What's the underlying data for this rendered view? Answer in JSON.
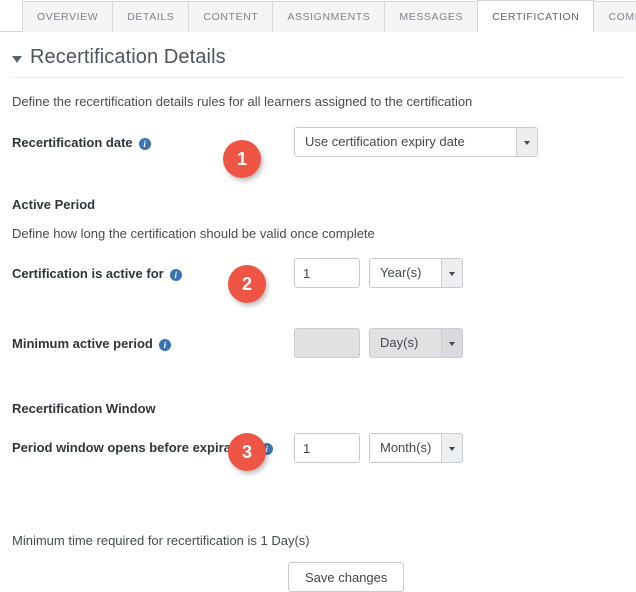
{
  "tabs": [
    {
      "label": "OVERVIEW",
      "active": false
    },
    {
      "label": "DETAILS",
      "active": false
    },
    {
      "label": "CONTENT",
      "active": false
    },
    {
      "label": "ASSIGNMENTS",
      "active": false
    },
    {
      "label": "MESSAGES",
      "active": false
    },
    {
      "label": "CERTIFICATION",
      "active": true
    },
    {
      "label": "COMPLETION",
      "active": false
    }
  ],
  "section": {
    "title": "Recertification Details",
    "intro": "Define the recertification details rules for all learners assigned to the certification"
  },
  "recertification_date": {
    "label": "Recertification date",
    "select_value": "Use certification expiry date"
  },
  "active_period": {
    "heading": "Active Period",
    "description": "Define how long the certification should be valid once complete",
    "active_for_label": "Certification is active for",
    "active_for_value": "1",
    "active_for_unit": "Year(s)",
    "minimum_label": "Minimum active period",
    "minimum_value": "",
    "minimum_unit": "Day(s)"
  },
  "recertification_window": {
    "heading": "Recertification Window",
    "label": "Period window opens before expiration",
    "value": "1",
    "unit": "Month(s)"
  },
  "footer": {
    "note": "Minimum time required for recertification is 1 Day(s)",
    "save_label": "Save changes"
  },
  "badges": {
    "one": "1",
    "two": "2",
    "three": "3"
  },
  "colors": {
    "badge": "#ef5544",
    "info_icon": "#3a74b0",
    "disabled_bg": "#dfe1e3"
  }
}
